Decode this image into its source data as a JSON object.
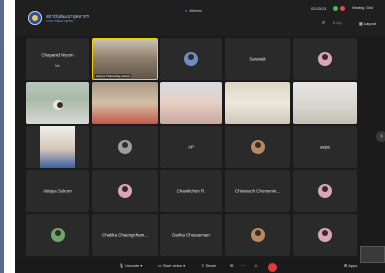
{
  "header": {
    "org_name": "สถาบันพัฒนาบุคลากร",
    "org_sub": "กรมการพัฒนาชุมชน",
    "app_title": "Webex",
    "timer": "02:03:21",
    "viewing": "Viewing: Grid",
    "page": "1 ◁ ▷",
    "layout": "Layout"
  },
  "tiles": [
    {
      "name": "Chayanid Niyom",
      "sub": "Me"
    },
    {
      "name": "Apinya Thanoshay (Host)"
    },
    {
      "name": ""
    },
    {
      "name": "Saranak"
    },
    {
      "name": ""
    },
    {
      "name": ""
    },
    {
      "name": ""
    },
    {
      "name": ""
    },
    {
      "name": ""
    },
    {
      "name": ""
    },
    {
      "name": ""
    },
    {
      "name": ""
    },
    {
      "name": "AP"
    },
    {
      "name": ""
    },
    {
      "name": "aepa"
    },
    {
      "name": "Atitaya Sukorn"
    },
    {
      "name": ""
    },
    {
      "name": "Chanikchon R."
    },
    {
      "name": "Chiranuch Chomenin..."
    },
    {
      "name": ""
    },
    {
      "name": ""
    },
    {
      "name": "Chatika Chaengcham..."
    },
    {
      "name": "Darika Chusaeman"
    },
    {
      "name": ""
    },
    {
      "name": ""
    }
  ],
  "toolbar": {
    "unmute": "🎙 Unmute ▾",
    "start_video": "▭ Start video ▾",
    "share": "⇧ Share",
    "apps": "⊞ Apps"
  },
  "colors": {
    "window_bg": "#1b1b1b",
    "tile_bg": "#2a2a2a",
    "active_speaker_border": "#f0d000",
    "end_call": "#e03b3b",
    "status_green": "#3bbf5a"
  }
}
